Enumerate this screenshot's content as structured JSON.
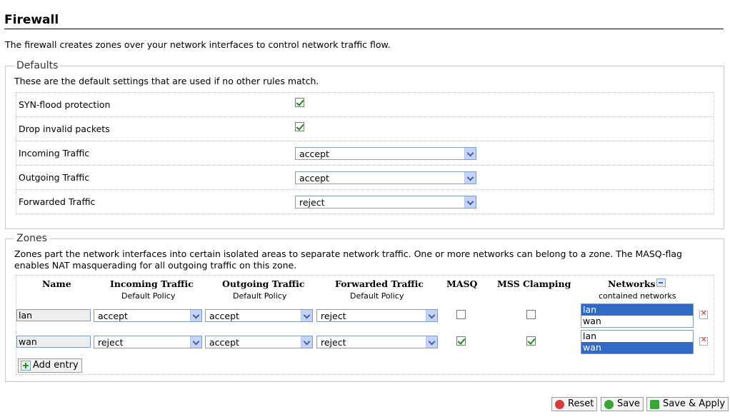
{
  "page": {
    "title": "Firewall",
    "intro": "The firewall creates zones over your network interfaces to control network traffic flow."
  },
  "defaults": {
    "legend": "Defaults",
    "description": "These are the default settings that are used if no other rules match.",
    "rows": [
      {
        "label": "SYN-flood protection",
        "type": "checkbox",
        "checked": true
      },
      {
        "label": "Drop invalid packets",
        "type": "checkbox",
        "checked": true
      },
      {
        "label": "Incoming Traffic",
        "type": "select",
        "value": "accept"
      },
      {
        "label": "Outgoing Traffic",
        "type": "select",
        "value": "accept"
      },
      {
        "label": "Forwarded Traffic",
        "type": "select",
        "value": "reject"
      }
    ]
  },
  "zones": {
    "legend": "Zones",
    "description_line1": "Zones part the network interfaces into certain isolated areas to separate network traffic. One or more networks can belong to a zone. The MASQ-flag",
    "description_line2": "enables NAT masquerading for all outgoing traffic on this zone.",
    "headers": {
      "name": "Name",
      "incoming": "Incoming Traffic",
      "incoming_sub": "Default Policy",
      "outgoing": "Outgoing Traffic",
      "outgoing_sub": "Default Policy",
      "forwarded": "Forwarded Traffic",
      "forwarded_sub": "Default Policy",
      "masq": "MASQ",
      "mss": "MSS Clamping",
      "networks": "Networks",
      "networks_sub": "contained networks"
    },
    "rows": [
      {
        "name": "lan",
        "incoming": "accept",
        "outgoing": "accept",
        "forwarded": "reject",
        "masq": false,
        "mss": false,
        "networks": [
          "lan",
          "wan"
        ],
        "selected_network": "lan"
      },
      {
        "name": "wan",
        "incoming": "reject",
        "outgoing": "accept",
        "forwarded": "reject",
        "masq": true,
        "mss": true,
        "networks": [
          "lan",
          "wan"
        ],
        "selected_network": "wan"
      }
    ],
    "add_entry_label": "Add entry"
  },
  "actions": {
    "reset": "Reset",
    "save": "Save",
    "save_apply": "Save & Apply"
  },
  "icons": {
    "checkbox_check_color": "#1a8a1a",
    "listbox_selected_color": "#316ac5"
  }
}
